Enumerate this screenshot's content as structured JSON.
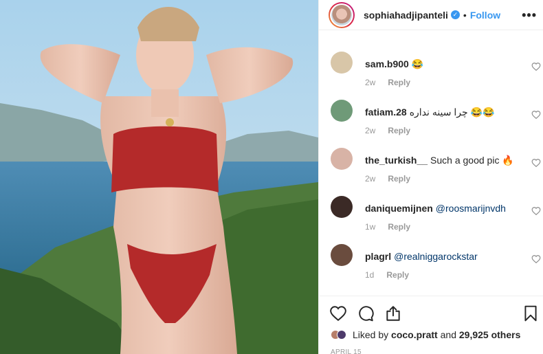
{
  "post": {
    "username": "sophiahadjipanteli",
    "verified_mark": "✓",
    "separator": "•",
    "follow_label": "Follow",
    "more_label": "•••"
  },
  "comments": [
    {
      "user": "sam.b900",
      "text": "😂",
      "time": "2w",
      "reply": "Reply",
      "avatar_color": "#d8c6a8"
    },
    {
      "user": "fatiam.28",
      "text": "چرا سینه نداره 😂😂",
      "time": "2w",
      "reply": "Reply",
      "avatar_color": "#6f9a78"
    },
    {
      "user": "the_turkish__",
      "text": "Such a good pic 🔥",
      "time": "2w",
      "reply": "Reply",
      "avatar_color": "#d8b3a6"
    },
    {
      "user": "daniquemijnen",
      "text": "@roosmarijnvdh",
      "time": "1w",
      "reply": "Reply",
      "avatar_color": "#3b2a26"
    },
    {
      "user": "plagrl",
      "text": "@realniggarockstar",
      "time": "1d",
      "reply": "Reply",
      "avatar_color": "#6a4c3e"
    }
  ],
  "icons": {
    "like": "heart-icon",
    "comment": "comment-icon",
    "share": "share-icon",
    "save": "bookmark-icon"
  },
  "likes": {
    "prefix": "Liked by",
    "first_user": "coco.pratt",
    "connector": "and",
    "others": "29,925 others"
  },
  "date": "APRIL 15",
  "colors": {
    "accent": "#3897f0",
    "muted": "#999999",
    "text": "#262626"
  }
}
